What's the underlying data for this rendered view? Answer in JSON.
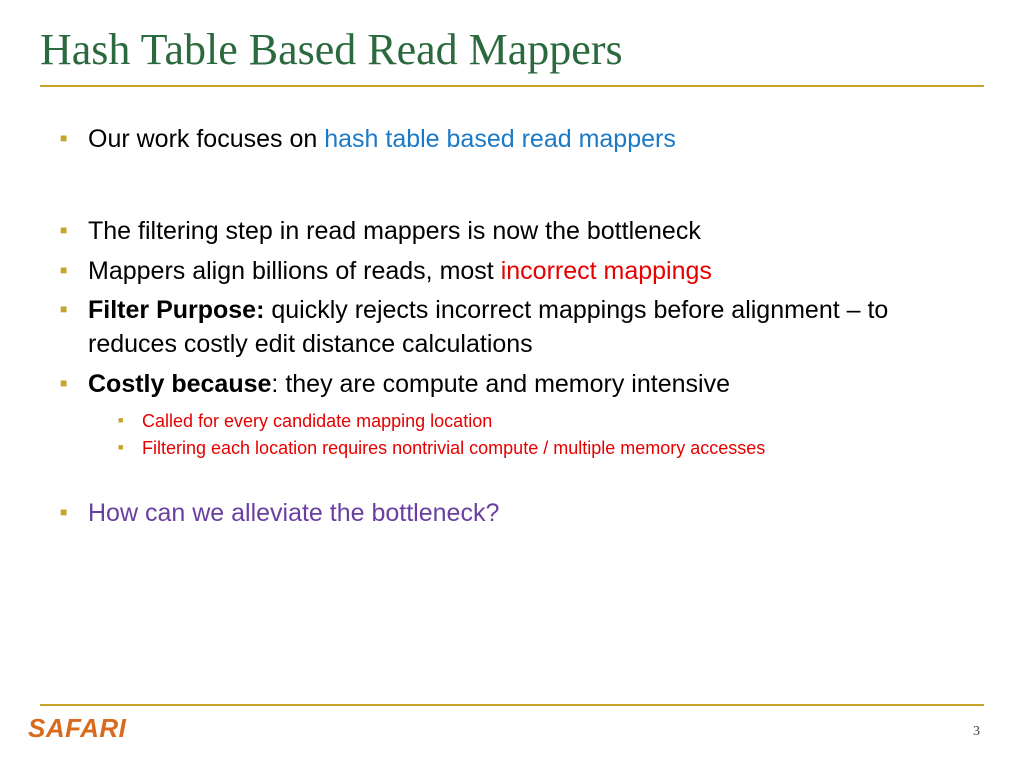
{
  "title": "Hash Table Based Read Mappers",
  "b1": {
    "a": "Our work focuses on ",
    "b": "hash table based read mappers"
  },
  "b2": "The filtering step in read mappers is now the bottleneck",
  "b3": {
    "a": "Mappers align billions of reads, most ",
    "b": "incorrect mappings"
  },
  "b4": {
    "a": "Filter Purpose:",
    "b": " quickly rejects incorrect mappings before alignment – to reduces costly edit distance calculations"
  },
  "b5": {
    "a": "Costly because",
    "b": ": they are compute and memory intensive"
  },
  "s1": "Called for every candidate mapping location",
  "s2": "Filtering each location requires nontrivial compute / multiple memory accesses",
  "b6": "How can we alleviate the bottleneck?",
  "logo": {
    "main": "SAFARI",
    "sub": ""
  },
  "page": "3"
}
